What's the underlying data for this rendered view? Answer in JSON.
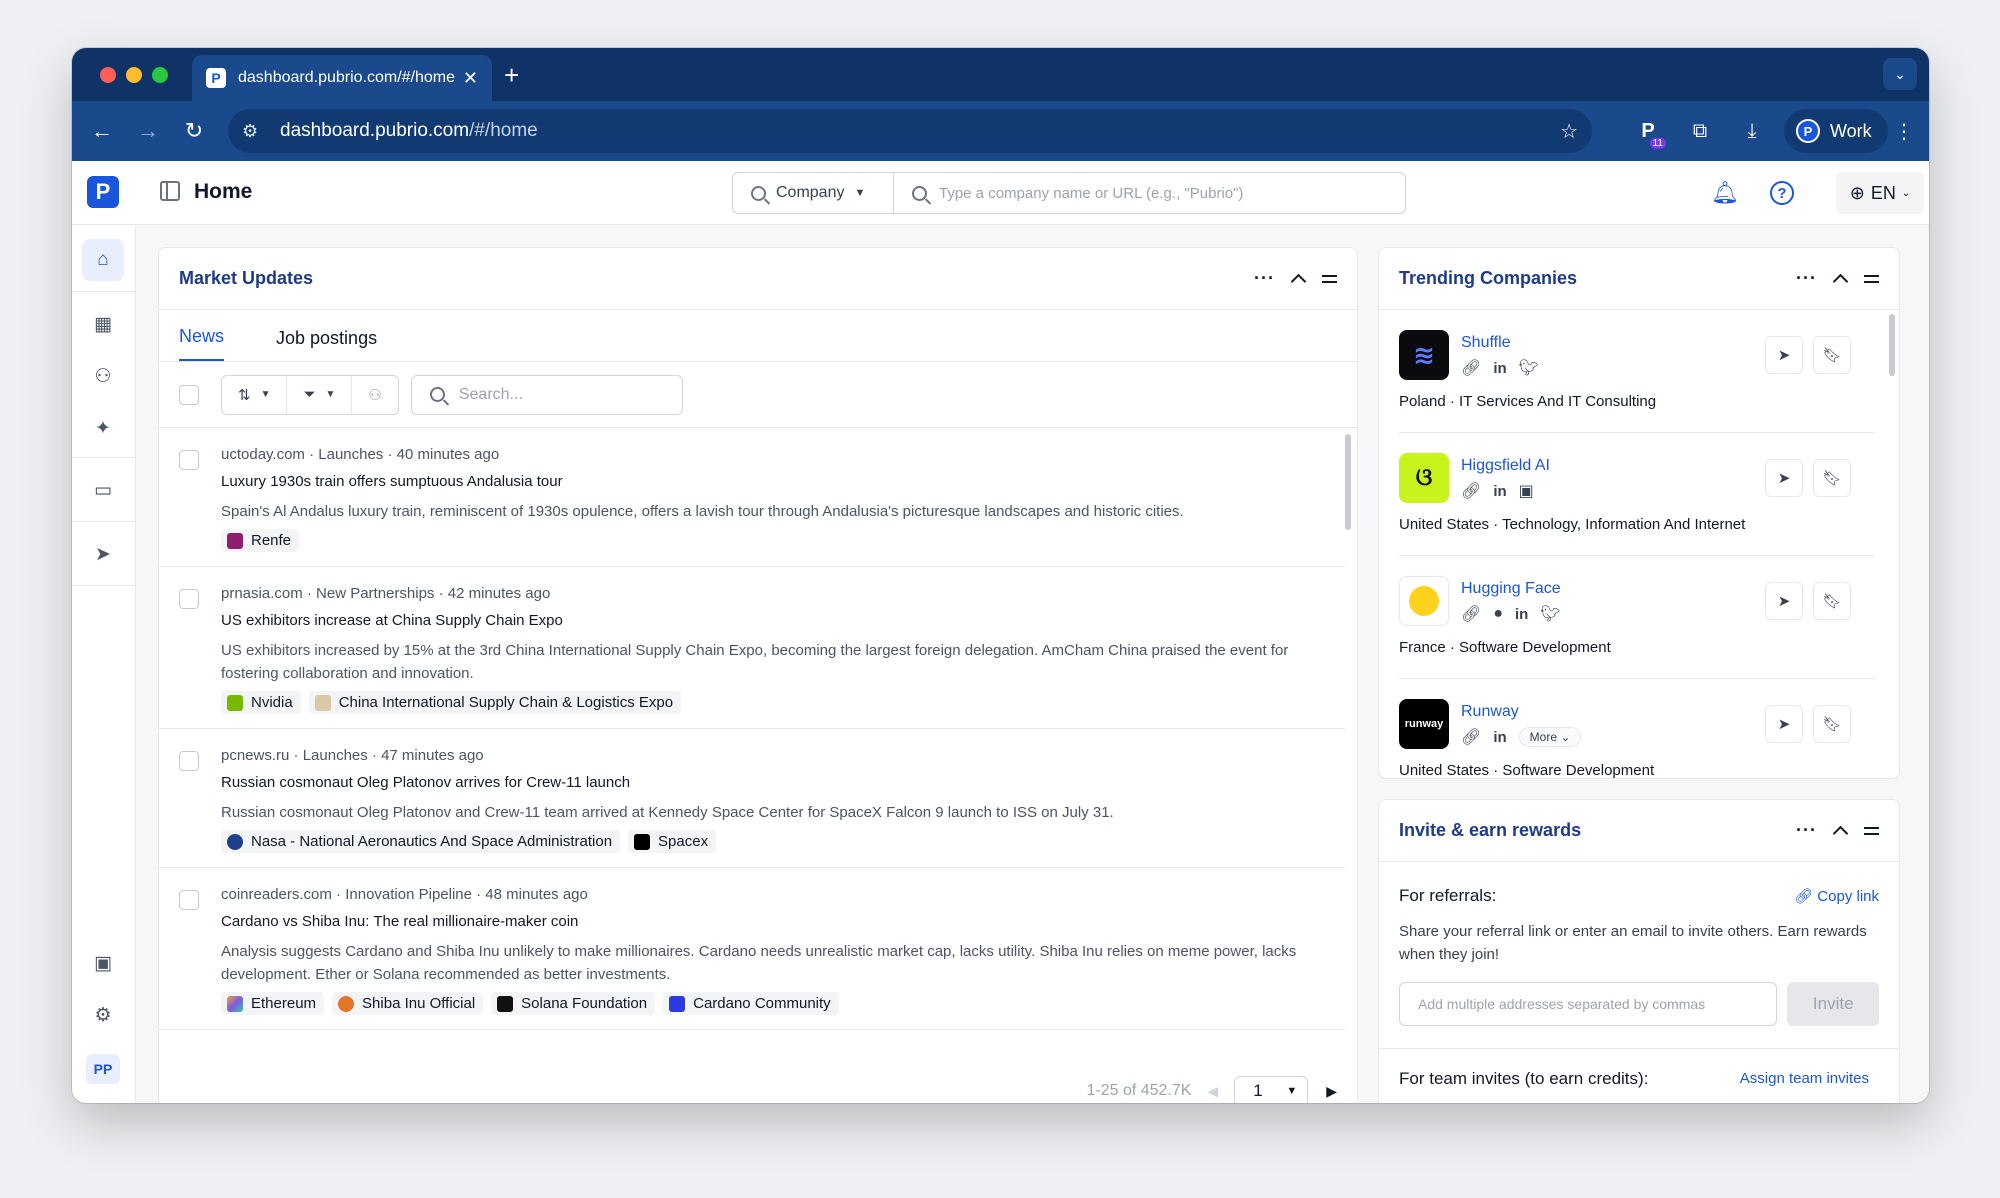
{
  "browser": {
    "tab_title": "dashboard.pubrio.com/#/home",
    "url_host": "dashboard.pubrio.com",
    "url_path": "/#/home",
    "profile_label": "Work",
    "ext_badge": "11"
  },
  "app": {
    "page_title": "Home",
    "search_type": "Company",
    "search_placeholder": "Type a company name or URL (e.g., \"Pubrio\")",
    "language": "EN",
    "user_initials": "PP"
  },
  "market": {
    "title": "Market Updates",
    "tabs": [
      "News",
      "Job postings"
    ],
    "search_placeholder": "Search...",
    "items": [
      {
        "meta": "uctoday.com · Launches · 40 minutes ago",
        "title": "Luxury 1930s train offers sumptuous Andalusia tour",
        "body": "Spain's Al Andalus luxury train, reminiscent of 1930s opulence, offers a lavish tour through Andalusia's picturesque landscapes and historic cities.",
        "tags": [
          "Renfe"
        ]
      },
      {
        "meta": "prnasia.com · New Partnerships · 42 minutes ago",
        "title": "US exhibitors increase at China Supply Chain Expo",
        "body": "US exhibitors increased by 15% at the 3rd China International Supply Chain Expo, becoming the largest foreign delegation. AmCham China praised the event for fostering collaboration and innovation.",
        "tags": [
          "Nvidia",
          "China International Supply Chain & Logistics Expo"
        ]
      },
      {
        "meta": "pcnews.ru · Launches · 47 minutes ago",
        "title": "Russian cosmonaut Oleg Platonov arrives for Crew-11 launch",
        "body": "Russian cosmonaut Oleg Platonov and Crew-11 team arrived at Kennedy Space Center for SpaceX Falcon 9 launch to ISS on July 31.",
        "tags": [
          "Nasa - National Aeronautics And Space Administration",
          "Spacex"
        ]
      },
      {
        "meta": "coinreaders.com · Innovation Pipeline · 48 minutes ago",
        "title": "Cardano vs Shiba Inu: The real millionaire-maker coin",
        "body": "Analysis suggests Cardano and Shiba Inu unlikely to make millionaires. Cardano needs unrealistic market cap, lacks utility. Shiba Inu relies on meme power, lacks development. Ether or Solana recommended as better investments.",
        "tags": [
          "Ethereum",
          "Shiba Inu Official",
          "Solana Foundation",
          "Cardano Community"
        ]
      }
    ],
    "pager_text": "1-25 of 452.7K",
    "page": "1"
  },
  "trending": {
    "title": "Trending Companies",
    "more_label": "More",
    "companies": [
      {
        "name": "Shuffle",
        "desc": "Poland · IT Services And IT Consulting",
        "logo_bg": "#0b0b0f"
      },
      {
        "name": "Higgsfield AI",
        "desc": "United States · Technology, Information And Internet",
        "logo_bg": "#c8f31d"
      },
      {
        "name": "Hugging Face",
        "desc": "France · Software Development",
        "logo_bg": "#ffffff"
      },
      {
        "name": "Runway",
        "desc": "United States · Software Development",
        "logo_bg": "#000000",
        "logo_text": "runway"
      }
    ]
  },
  "invite": {
    "title": "Invite & earn rewards",
    "referral_label": "For referrals:",
    "copy_link": "Copy link",
    "description": "Share your referral link or enter an email to invite others. Earn rewards when they join!",
    "email_placeholder": "Add multiple addresses separated by commas",
    "invite_button": "Invite",
    "team_label": "For team invites (to earn credits):",
    "team_link": "Assign team invites"
  },
  "colors": {
    "brand": "#1a56db",
    "chrome_dark": "#0f3366",
    "chrome": "#1b4a8c"
  }
}
